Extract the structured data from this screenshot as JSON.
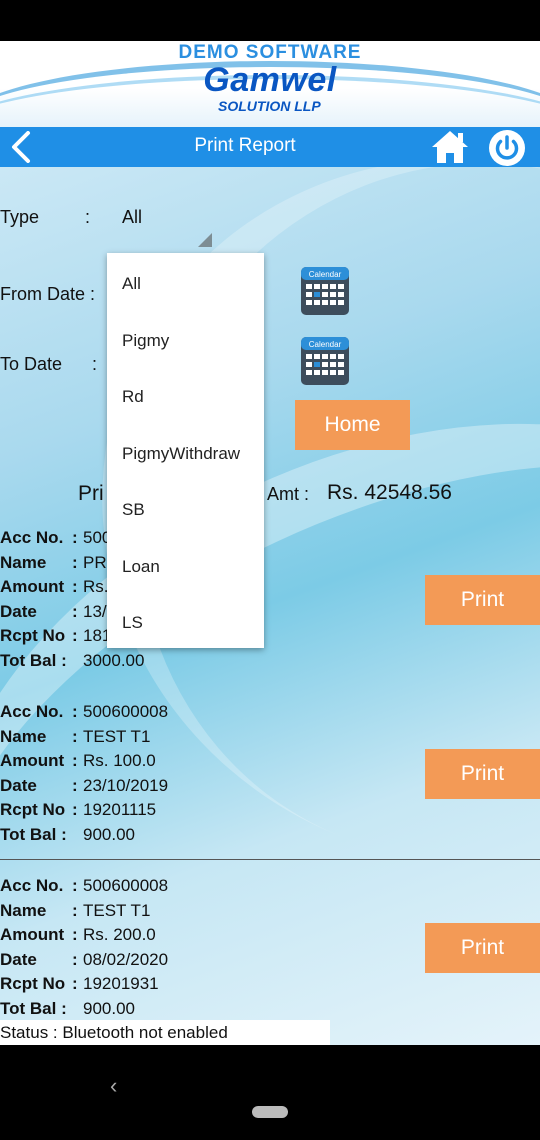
{
  "header": {
    "demo_label": "DEMO SOFTWARE",
    "logo_main": "Gamwel",
    "logo_sub": "SOLUTION LLP",
    "title": "Print Report"
  },
  "form": {
    "type_label": "Type",
    "type_sep": ":",
    "type_value": "All",
    "from_label": "From Date :",
    "to_label": "To Date",
    "to_sep": ":",
    "calendar_text": "Calendar",
    "home_button": "Home"
  },
  "total": {
    "label_left": "Pri",
    "label_right": "l Amt :",
    "value": "Rs. 42548.56"
  },
  "records": [
    {
      "rows": [
        {
          "key": "Acc No.",
          "sep": ":",
          "val": "500"
        },
        {
          "key": "Name",
          "sep": ":",
          "val": "PR"
        },
        {
          "key": "Amount",
          "sep": ":",
          "val": "Rs."
        },
        {
          "key": "Date",
          "sep": ":",
          "val": "13/"
        },
        {
          "key": "Rcpt No",
          "sep": ":",
          "val": "181"
        },
        {
          "key": "Tot Bal :",
          "sep": "",
          "val": "3000.00"
        }
      ],
      "print_label": "Print"
    },
    {
      "rows": [
        {
          "key": "Acc No.",
          "sep": ":",
          "val": "500600008"
        },
        {
          "key": "Name",
          "sep": ":",
          "val": "TEST T1"
        },
        {
          "key": "Amount",
          "sep": ":",
          "val": "Rs. 100.0"
        },
        {
          "key": "Date",
          "sep": ":",
          "val": "23/10/2019"
        },
        {
          "key": "Rcpt No",
          "sep": ":",
          "val": "19201115"
        },
        {
          "key": "Tot Bal :",
          "sep": "",
          "val": "900.00"
        }
      ],
      "print_label": "Print"
    },
    {
      "rows": [
        {
          "key": "Acc No.",
          "sep": ":",
          "val": "500600008"
        },
        {
          "key": "Name",
          "sep": ":",
          "val": "TEST T1"
        },
        {
          "key": "Amount",
          "sep": ":",
          "val": "Rs. 200.0"
        },
        {
          "key": "Date",
          "sep": ":",
          "val": "08/02/2020"
        },
        {
          "key": "Rcpt No",
          "sep": ":",
          "val": "19201931"
        },
        {
          "key": "Tot Bal :",
          "sep": "",
          "val": "900.00"
        }
      ],
      "print_label": "Print"
    }
  ],
  "status": "Status : Bluetooth not enabled",
  "dropdown": {
    "options": [
      "All",
      "Pigmy",
      "Rd",
      "PigmyWithdraw",
      "SB",
      "Loan",
      "LS"
    ]
  },
  "colors": {
    "nav_bar": "#1f8fe6",
    "button": "#f39a56",
    "logo": "#0a56c2"
  },
  "icons": {
    "back": "chevron-left-icon",
    "home": "home-icon",
    "power": "power-icon",
    "calendar": "calendar-icon"
  }
}
